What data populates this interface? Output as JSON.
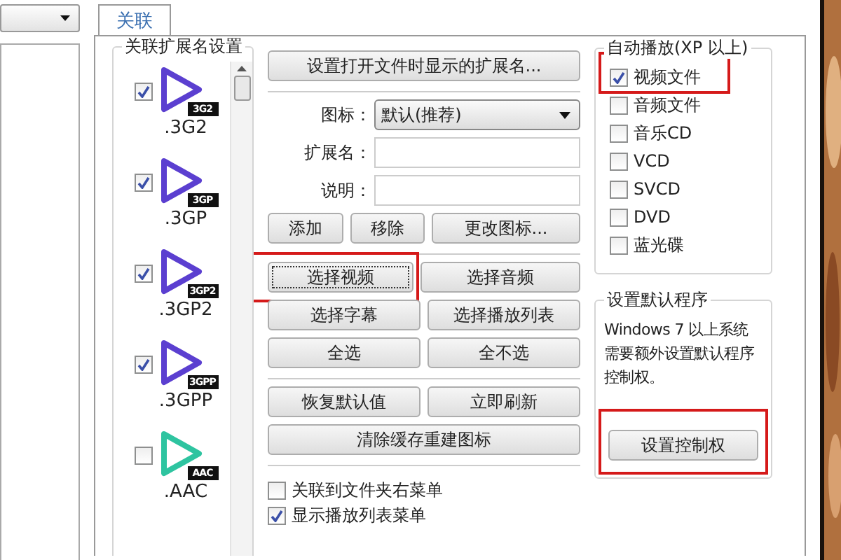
{
  "tabs": [
    {
      "label": "关联",
      "selected": true
    }
  ],
  "extensions": {
    "title": "关联扩展名设置",
    "items": [
      {
        "label": ".3G2",
        "badge": "3G2",
        "checked": true,
        "color": "#5b3fd0"
      },
      {
        "label": ".3GP",
        "badge": "3GP",
        "checked": true,
        "color": "#5b3fd0"
      },
      {
        "label": ".3GP2",
        "badge": "3GP2",
        "checked": true,
        "color": "#5b3fd0"
      },
      {
        "label": ".3GPP",
        "badge": "3GPP",
        "checked": true,
        "color": "#5b3fd0"
      },
      {
        "label": ".AAC",
        "badge": "AAC",
        "checked": false,
        "color": "#2ec4a0"
      }
    ]
  },
  "settings": {
    "top_button": "设置打开文件时显示的扩展名...",
    "fields": [
      {
        "kind": "select",
        "label": "图标：",
        "value": "默认(推荐)"
      },
      {
        "kind": "text",
        "label": "扩展名："
      },
      {
        "kind": "text",
        "label": "说明："
      }
    ],
    "groups": [
      [
        [
          {
            "label": "添加",
            "highlighted": false
          },
          {
            "label": "移除",
            "highlighted": false
          },
          {
            "label": "更改图标...",
            "highlighted": false
          }
        ]
      ],
      [
        [
          {
            "label": "选择视频",
            "highlighted": true
          },
          {
            "label": "选择音频",
            "highlighted": false
          }
        ],
        [
          {
            "label": "选择字幕",
            "highlighted": false
          },
          {
            "label": "选择播放列表",
            "highlighted": false
          }
        ],
        [
          {
            "label": "全选",
            "highlighted": false
          },
          {
            "label": "全不选",
            "highlighted": false
          }
        ]
      ],
      [
        [
          {
            "label": "恢复默认值",
            "highlighted": false
          },
          {
            "label": "立即刷新",
            "highlighted": false
          }
        ],
        [
          {
            "label": "清除缓存重建图标",
            "highlighted": false
          }
        ]
      ]
    ],
    "options": [
      {
        "label": "关联到文件夹右菜单",
        "checked": false
      },
      {
        "label": "显示播放列表菜单",
        "checked": true
      }
    ]
  },
  "autoplay": {
    "title": "自动播放(XP 以上)",
    "items": [
      {
        "label": "视频文件",
        "checked": true,
        "highlighted": true
      },
      {
        "label": "音频文件",
        "checked": false,
        "highlighted": false
      },
      {
        "label": "音乐CD",
        "checked": false,
        "highlighted": false
      },
      {
        "label": "VCD",
        "checked": false,
        "highlighted": false
      },
      {
        "label": "SVCD",
        "checked": false,
        "highlighted": false
      },
      {
        "label": "DVD",
        "checked": false,
        "highlighted": false
      },
      {
        "label": "蓝光碟",
        "checked": false,
        "highlighted": false
      }
    ]
  },
  "default_program": {
    "title": "设置默认程序",
    "text": "Windows 7 以上系统需要额外设置默认程序控制权。",
    "button": {
      "label": "设置控制权",
      "highlighted": true
    }
  }
}
